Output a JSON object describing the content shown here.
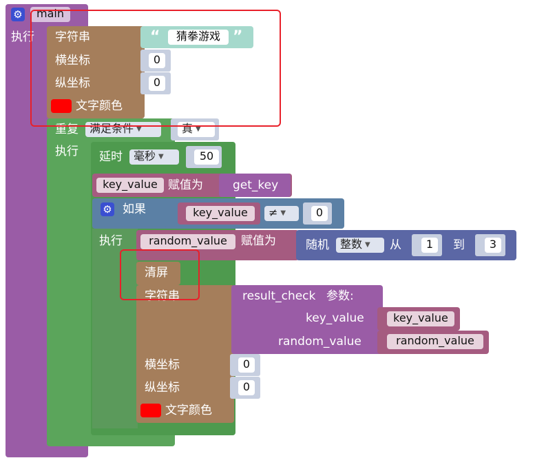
{
  "main_block": {
    "name": "main",
    "exec_label": "执行"
  },
  "string_block_1": {
    "label": "字符串",
    "text_value": "猜拳游戏",
    "x_label": "横坐标",
    "x_value": "0",
    "y_label": "纵坐标",
    "y_value": "0",
    "color_label": "文字颜色",
    "color": "#ff0000"
  },
  "repeat_block": {
    "label": "重复",
    "mode": "满足条件",
    "condition": "真",
    "exec_label": "执行"
  },
  "delay_block": {
    "label": "延时",
    "unit": "毫秒",
    "value": "50"
  },
  "assign_key": {
    "var": "key_value",
    "assign_label": "赋值为",
    "func": "get_key"
  },
  "if_block": {
    "label": "如果",
    "left": "key_value",
    "operator": "≠",
    "right": "0",
    "exec_label": "执行"
  },
  "assign_random": {
    "var": "random_value",
    "assign_label": "赋值为",
    "random_label": "随机",
    "type": "整数",
    "from_label": "从",
    "from_value": "1",
    "to_label": "到",
    "to_value": "3"
  },
  "clear_block": {
    "label": "清屏"
  },
  "string_block_2": {
    "label": "字符串",
    "func": "result_check",
    "params_label": "参数:",
    "param1_name": "key_value",
    "param1_value": "key_value",
    "param2_name": "random_value",
    "param2_value": "random_value",
    "x_label": "横坐标",
    "x_value": "0",
    "y_label": "纵坐标",
    "y_value": "0",
    "color_label": "文字颜色",
    "color": "#ff0000"
  },
  "colors": {
    "purple": "#9a5ca6",
    "brown": "#a57e5b",
    "green": "#5ba55b",
    "teal": "#a5d9cc",
    "blue": "#5b80a5",
    "navy": "#5b67a5",
    "maroon": "#a55b80",
    "highlight": "#e8202a"
  }
}
